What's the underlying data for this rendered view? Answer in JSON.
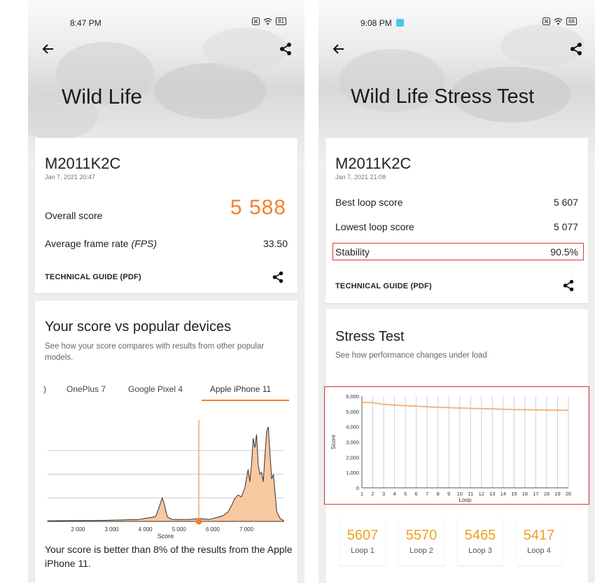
{
  "left": {
    "status_time": "8:47 PM",
    "battery": "81",
    "title": "Wild Life",
    "device": "M2011K2C",
    "date": "Jan 7, 2021 20:47",
    "overall_label": "Overall score",
    "overall_value": "5 588",
    "fps_label_main": "Average frame rate ",
    "fps_label_unit": "(FPS)",
    "fps_value": "33.50",
    "tech_guide": "TECHNICAL GUIDE (PDF)",
    "compare_title": "Your score vs popular devices",
    "compare_sub": "See how your score compares with results from other popular models.",
    "tabs": [
      ")",
      "OnePlus 7",
      "Google Pixel 4",
      "Apple iPhone 11"
    ],
    "active_tab": "Apple iPhone 11",
    "result_text": "Your score is better than 8% of the results from the Apple iPhone 11."
  },
  "right": {
    "status_time": "9:08 PM",
    "battery": "66",
    "title": "Wild Life Stress Test",
    "device": "M2011K2C",
    "date": "Jan 7, 2021 21:08",
    "best_label": "Best loop score",
    "best_value": "5 607",
    "lowest_label": "Lowest loop score",
    "lowest_value": "5 077",
    "stability_label": "Stability",
    "stability_value": "90.5%",
    "tech_guide": "TECHNICAL GUIDE (PDF)",
    "stress_title": "Stress Test",
    "stress_sub": "See how performance changes under load",
    "loops": [
      {
        "score": "5607",
        "label": "Loop 1"
      },
      {
        "score": "5570",
        "label": "Loop 2"
      },
      {
        "score": "5465",
        "label": "Loop 3"
      },
      {
        "score": "5417",
        "label": "Loop 4"
      }
    ]
  },
  "colors": {
    "accent_orange": "#f08030",
    "loop_score": "#f0a020",
    "highlight_red": "#d9343a",
    "stress_line": "#f5b57a"
  },
  "chart_data": [
    {
      "type": "area",
      "title": "",
      "xlabel": "Score",
      "ylabel": "",
      "x_ticks": [
        "2 000",
        "3 000",
        "4 000",
        "5 000",
        "6 000",
        "7 000"
      ],
      "xlim": [
        1100,
        8100
      ],
      "marker_score": 5588,
      "series": [
        {
          "x": [
            1100,
            1800,
            2500,
            3200,
            3800,
            4300,
            4400,
            4500,
            4550,
            4650,
            4800,
            5300,
            5600,
            5900,
            6100,
            6300,
            6450,
            6550,
            6650,
            6750,
            6850,
            6950,
            7050,
            7100,
            7150,
            7200,
            7250,
            7300,
            7350,
            7400,
            7450,
            7500,
            7550,
            7600,
            7650,
            7700,
            7750,
            7800,
            7850,
            7900,
            8000,
            8100
          ],
          "y": [
            0.005,
            0.01,
            0.01,
            0.015,
            0.02,
            0.05,
            0.14,
            0.25,
            0.2,
            0.05,
            0.02,
            0.02,
            0.03,
            0.02,
            0.04,
            0.06,
            0.1,
            0.16,
            0.24,
            0.28,
            0.26,
            0.35,
            0.55,
            0.42,
            0.6,
            0.88,
            0.78,
            0.92,
            0.6,
            0.5,
            0.52,
            0.42,
            0.7,
            0.95,
            1.0,
            0.72,
            0.45,
            0.5,
            0.3,
            0.1,
            0.03,
            0.01
          ]
        }
      ]
    },
    {
      "type": "line",
      "title": "",
      "xlabel": "Loop",
      "ylabel": "Score",
      "ylim": [
        0,
        6000
      ],
      "y_ticks": [
        "0",
        "1,000",
        "2,000",
        "3,000",
        "4,000",
        "5,000",
        "6,000"
      ],
      "categories": [
        "1",
        "2",
        "3",
        "4",
        "5",
        "6",
        "7",
        "8",
        "9",
        "10",
        "11",
        "12",
        "13",
        "14",
        "15",
        "16",
        "17",
        "18",
        "19",
        "20"
      ],
      "series": [
        {
          "values": [
            5607,
            5570,
            5465,
            5417,
            5380,
            5340,
            5300,
            5270,
            5250,
            5220,
            5200,
            5180,
            5160,
            5140,
            5120,
            5110,
            5100,
            5090,
            5080,
            5077
          ]
        }
      ]
    }
  ]
}
